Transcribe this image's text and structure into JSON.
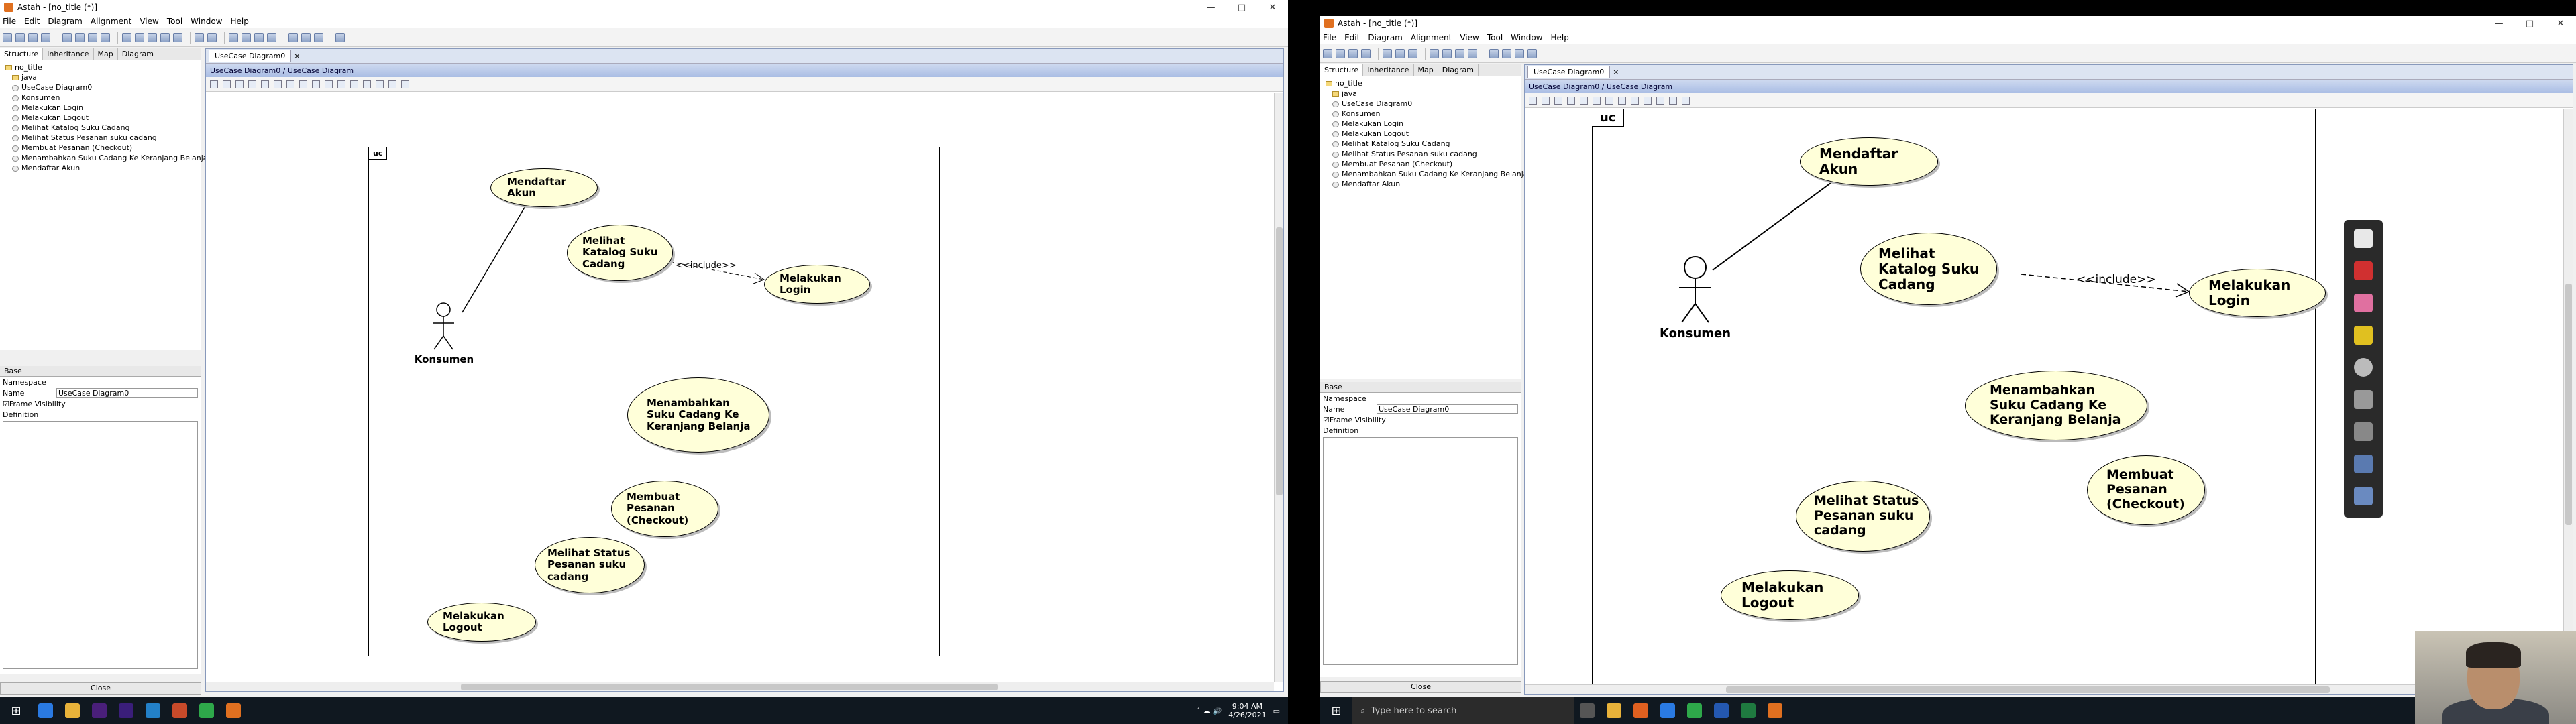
{
  "window": {
    "title": "Astah - [no_title (*)]",
    "controls": [
      "—",
      "□",
      "✕"
    ]
  },
  "menu": [
    "File",
    "Edit",
    "Diagram",
    "Alignment",
    "View",
    "Tool",
    "Window",
    "Help"
  ],
  "left_tabs": [
    "Structure",
    "Inheritance",
    "Map",
    "Diagram"
  ],
  "tree": [
    {
      "label": "no_title",
      "icon": "folder"
    },
    {
      "label": "java",
      "icon": "folder"
    },
    {
      "label": "UseCase Diagram0",
      "icon": "diagram"
    },
    {
      "label": "Konsumen",
      "icon": "actor"
    },
    {
      "label": "Melakukan Login",
      "icon": "usecase"
    },
    {
      "label": "Melakukan Logout",
      "icon": "usecase"
    },
    {
      "label": "Melihat Katalog Suku Cadang",
      "icon": "usecase"
    },
    {
      "label": "Melihat Status Pesanan suku cadang",
      "icon": "usecase"
    },
    {
      "label": "Membuat Pesanan (Checkout)",
      "icon": "usecase"
    },
    {
      "label": "Menambahkan Suku Cadang Ke Keranjang Belanja",
      "icon": "usecase"
    },
    {
      "label": "Mendaftar Akun",
      "icon": "usecase"
    }
  ],
  "props": {
    "tab": "Base",
    "namespace_label": "Namespace",
    "name_label": "Name",
    "name_value": "UseCase Diagram0",
    "frame_visibility": "Frame Visibility",
    "definition_label": "Definition",
    "close_label": "Close"
  },
  "editor": {
    "doc_tab": "UseCase Diagram0",
    "breadcrumb": "UseCase Diagram0 / UseCase Diagram"
  },
  "diagram": {
    "frame_tag": "uc",
    "actor": "Konsumen",
    "include_label": "<<include>>",
    "usecases": {
      "mendaftar": "Mendaftar\nAkun",
      "katalog": "Melihat\nKatalog Suku\nCadang",
      "login": "Melakukan\nLogin",
      "menambahkan": "Menambahkan\nSuku Cadang Ke\nKeranjang Belanja",
      "membuat": "Membuat\nPesanan\n(Checkout)",
      "status": "Melihat Status\nPesanan suku\ncadang",
      "logout": "Melakukan\nLogout"
    }
  },
  "taskbar": {
    "search_placeholder": "Type here to search",
    "time": "9:04 AM",
    "date": "4/26/2021"
  },
  "colors": {
    "usecase_fill": "#ffffd9",
    "taskbar": "#101820",
    "titlebar_accent": "#e07020"
  }
}
